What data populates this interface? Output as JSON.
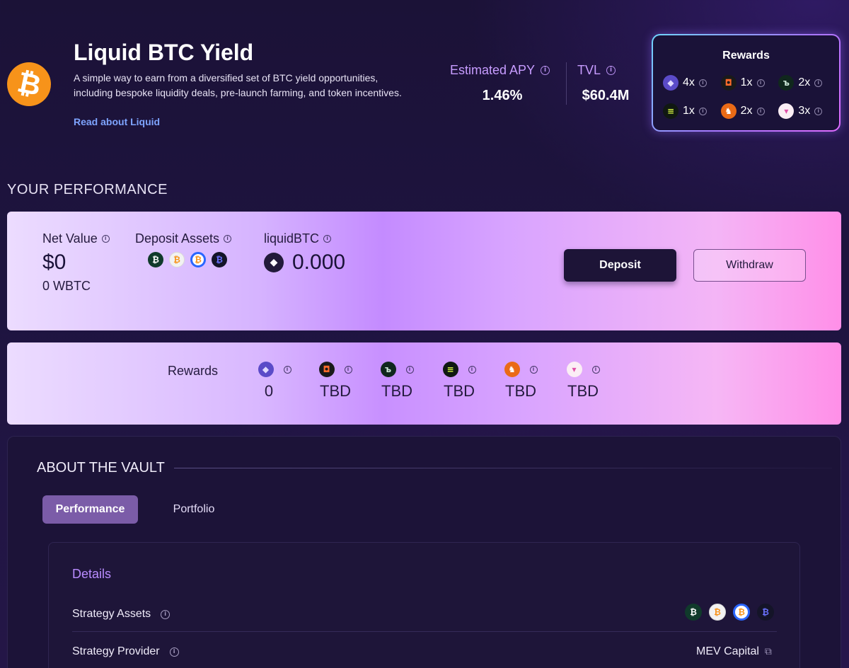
{
  "header": {
    "title": "Liquid BTC Yield",
    "description": "A simple way to earn from a diversified set of BTC yield opportunities, including bespoke liquidity deals, pre-launch farming, and token incentives.",
    "read_link": "Read about Liquid",
    "logo_icon": "bitcoin-icon",
    "apy_label": "Estimated APY",
    "apy_value": "1.46%",
    "tvl_label": "TVL",
    "tvl_value": "$60.4M"
  },
  "rewards_box": {
    "title": "Rewards",
    "items": [
      {
        "icon": "ether-fi-icon",
        "multiplier": "4x"
      },
      {
        "icon": "karak-icon",
        "multiplier": "1x"
      },
      {
        "icon": "symbiotic-icon",
        "multiplier": "2x"
      },
      {
        "icon": "ethena-icon",
        "multiplier": "1x"
      },
      {
        "icon": "veda-icon",
        "multiplier": "2x"
      },
      {
        "icon": "lombard-icon",
        "multiplier": "3x"
      }
    ]
  },
  "performance": {
    "section_title": "YOUR PERFORMANCE",
    "net_value_label": "Net Value",
    "net_value": "$0",
    "net_value_sub": "0 WBTC",
    "deposit_assets_label": "Deposit Assets",
    "deposit_assets": [
      "wbtc-green-icon",
      "btc-white-icon",
      "cbbtc-icon",
      "lbtc-dark-icon"
    ],
    "token_label": "liquidBTC",
    "token_value": "0.000",
    "deposit_button": "Deposit",
    "withdraw_button": "Withdraw"
  },
  "rewards_row": {
    "label": "Rewards",
    "items": [
      {
        "icon": "ether-fi-icon",
        "value": "0"
      },
      {
        "icon": "karak-icon",
        "value": "TBD"
      },
      {
        "icon": "symbiotic-icon",
        "value": "TBD"
      },
      {
        "icon": "ethena-icon",
        "value": "TBD"
      },
      {
        "icon": "veda-icon",
        "value": "TBD"
      },
      {
        "icon": "lombard-icon",
        "value": "TBD"
      }
    ]
  },
  "about": {
    "title": "ABOUT THE VAULT",
    "tabs": [
      {
        "label": "Performance",
        "active": true
      },
      {
        "label": "Portfolio",
        "active": false
      }
    ],
    "details_title": "Details",
    "strategy_assets_label": "Strategy Assets",
    "strategy_provider_label": "Strategy Provider",
    "strategy_provider_value": "MEV Capital"
  },
  "colors": {
    "accent_purple": "#c79cff",
    "link_blue": "#7ea4ff",
    "btc_orange": "#f7931a",
    "deposit_button": "#1d1437"
  }
}
